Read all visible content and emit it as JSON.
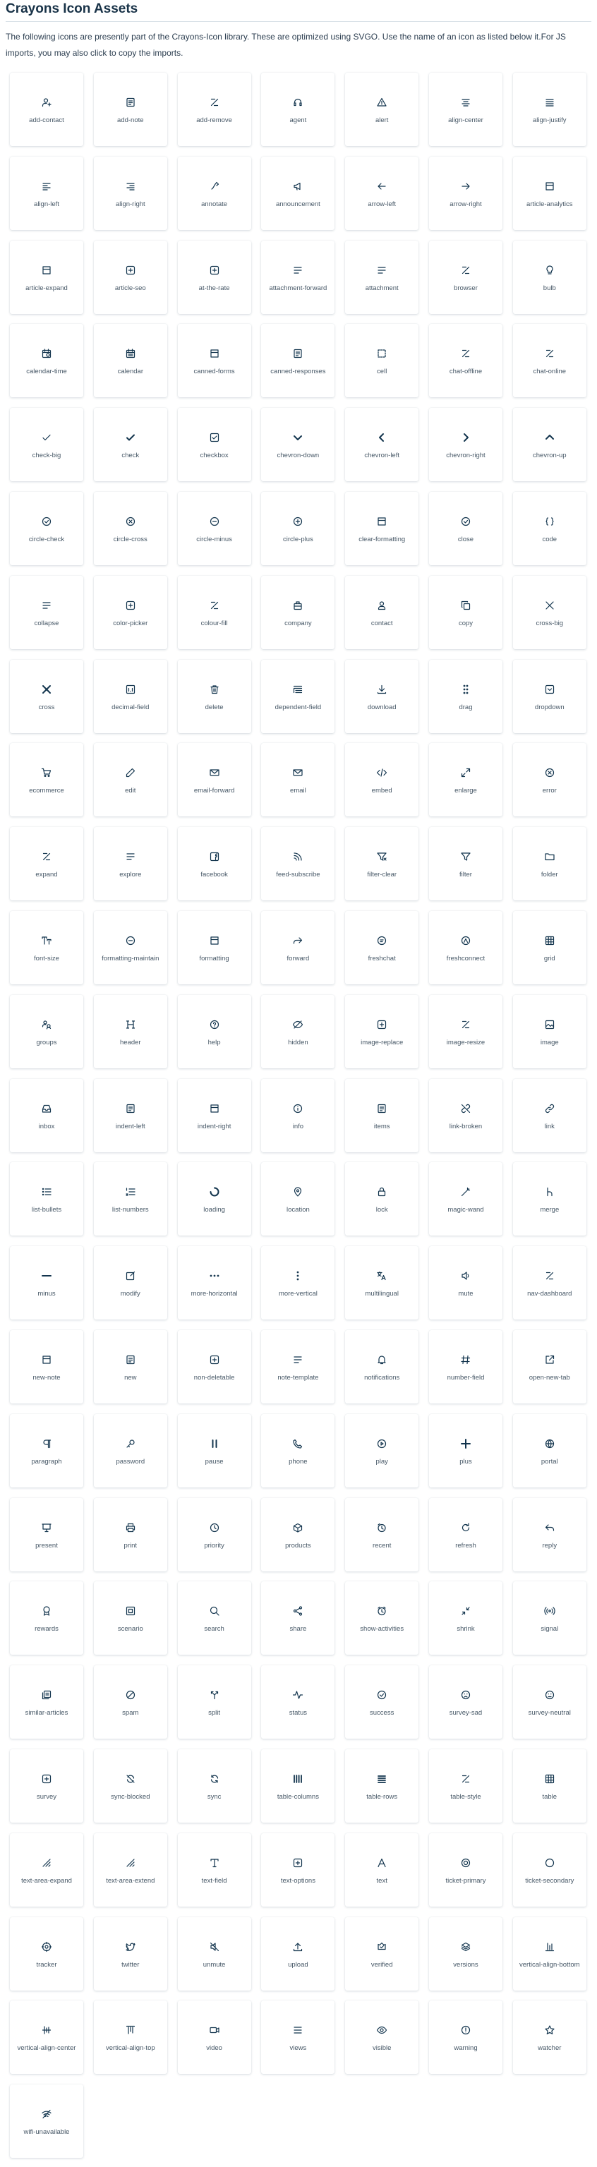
{
  "header": {
    "title": "Crayons Icon Assets",
    "description": "The following icons are presently part of the Crayons-Icon library. These are optimized using SVGO. Use the name of an icon as listed below it.For JS imports, you may also click to copy the imports."
  },
  "icons": [
    "add-contact",
    "add-note",
    "add-remove",
    "agent",
    "alert",
    "align-center",
    "align-justify",
    "align-left",
    "align-right",
    "annotate",
    "announcement",
    "arrow-left",
    "arrow-right",
    "article-analytics",
    "article-expand",
    "article-seo",
    "at-the-rate",
    "attachment-forward",
    "attachment",
    "browser",
    "bulb",
    "calendar-time",
    "calendar",
    "canned-forms",
    "canned-responses",
    "cell",
    "chat-offline",
    "chat-online",
    "check-big",
    "check",
    "checkbox",
    "chevron-down",
    "chevron-left",
    "chevron-right",
    "chevron-up",
    "circle-check",
    "circle-cross",
    "circle-minus",
    "circle-plus",
    "clear-formatting",
    "close",
    "code",
    "collapse",
    "color-picker",
    "colour-fill",
    "company",
    "contact",
    "copy",
    "cross-big",
    "cross",
    "decimal-field",
    "delete",
    "dependent-field",
    "download",
    "drag",
    "dropdown",
    "ecommerce",
    "edit",
    "email-forward",
    "email",
    "embed",
    "enlarge",
    "error",
    "expand",
    "explore",
    "facebook",
    "feed-subscribe",
    "filter-clear",
    "filter",
    "folder",
    "font-size",
    "formatting-maintain",
    "formatting",
    "forward",
    "freshchat",
    "freshconnect",
    "grid",
    "groups",
    "header",
    "help",
    "hidden",
    "image-replace",
    "image-resize",
    "image",
    "inbox",
    "indent-left",
    "indent-right",
    "info",
    "items",
    "link-broken",
    "link",
    "list-bullets",
    "list-numbers",
    "loading",
    "location",
    "lock",
    "magic-wand",
    "merge",
    "minus",
    "modify",
    "more-horizontal",
    "more-vertical",
    "multilingual",
    "mute",
    "nav-dashboard",
    "new-note",
    "new",
    "non-deletable",
    "note-template",
    "notifications",
    "number-field",
    "open-new-tab",
    "paragraph",
    "password",
    "pause",
    "phone",
    "play",
    "plus",
    "portal",
    "present",
    "print",
    "priority",
    "products",
    "recent",
    "refresh",
    "reply",
    "rewards",
    "scenario",
    "search",
    "share",
    "show-activities",
    "shrink",
    "signal",
    "similar-articles",
    "spam",
    "split",
    "status",
    "success",
    "survey-sad",
    "survey-neutral",
    "survey",
    "sync-blocked",
    "sync",
    "table-columns",
    "table-rows",
    "table-style",
    "table",
    "text-area-expand",
    "text-area-extend",
    "text-field",
    "text-options",
    "text",
    "ticket-primary",
    "ticket-secondary",
    "tracker",
    "twitter",
    "unmute",
    "upload",
    "verified",
    "versions",
    "vertical-align-bottom",
    "vertical-align-center",
    "vertical-align-top",
    "video",
    "views",
    "visible",
    "warning",
    "watcher",
    "wifi-unavailable"
  ]
}
